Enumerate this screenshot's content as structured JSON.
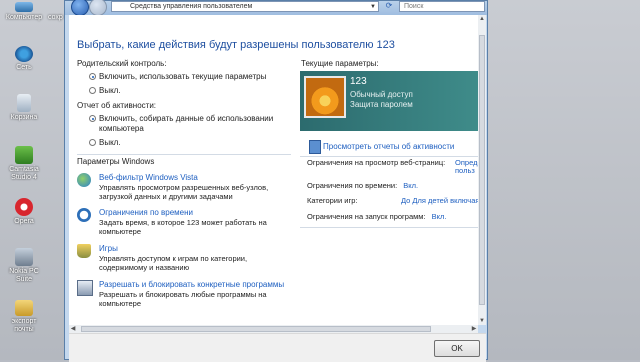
{
  "desktop": {
    "icons": [
      {
        "label": "Компьютер"
      },
      {
        "label": "Сеть"
      },
      {
        "label": "Корзина"
      },
      {
        "label": "Camtasia Studio 4"
      },
      {
        "label": "Opera"
      },
      {
        "label": "Nokia PC Suite"
      },
      {
        "label": "экспорт почты"
      }
    ],
    "partial_label": "сохр ст"
  },
  "window": {
    "address": "Средства управления пользователем",
    "search_placeholder": "Поиск",
    "heading": "Выбрать, какие действия будут разрешены пользователю 123",
    "parental": {
      "label": "Родительский контроль:",
      "options": [
        "Включить, использовать текущие параметры",
        "Выкл."
      ]
    },
    "activity": {
      "label": "Отчет об активности:",
      "options": [
        "Включить, собирать данные об использовании",
        "компьютера",
        "Выкл."
      ]
    },
    "windows_params": {
      "label": "Параметры Windows",
      "items": [
        {
          "link": "Веб-фильтр Windows Vista",
          "desc": "Управлять просмотром разрешенных веб-узлов, загрузкой данных и другими задачами"
        },
        {
          "link": "Ограничения по времени",
          "desc": "Задать время, в которое 123 может работать на компьютере"
        },
        {
          "link": "Игры",
          "desc": "Управлять доступом к играм по категории, содержимому и названию"
        },
        {
          "link": "Разрешать и блокировать конкретные программы",
          "desc": "Разрешать и блокировать любые программы на компьютере"
        }
      ]
    },
    "current": {
      "label": "Текущие параметры:",
      "user_name": "123",
      "account_type": "Обычный доступ",
      "password": "Защита паролем",
      "activity_link": "Просмотреть отчеты об активности",
      "rows": [
        {
          "label": "Ограничения на просмотр веб-страниц:",
          "value": "Опреде"
        },
        {
          "label": "",
          "value": "польз"
        },
        {
          "label": "Ограничения по времени:",
          "value": "Вкл."
        },
        {
          "label": "Категории игр:",
          "value": "До Для детей включая"
        },
        {
          "label": "Ограничения на запуск программ:",
          "value": "Вкл."
        }
      ]
    },
    "ok_label": "OK"
  }
}
